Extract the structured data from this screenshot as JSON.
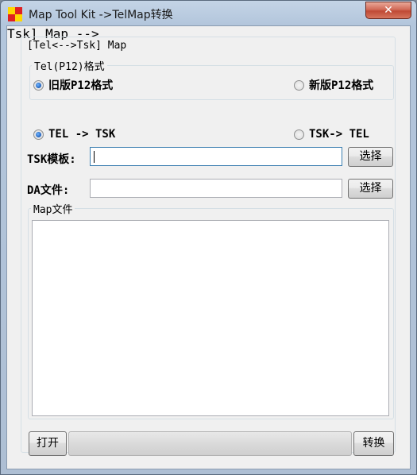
{
  "window": {
    "title": "Map Tool Kit ->TelMap转换",
    "close_label": "✕"
  },
  "main_group": {
    "title": "[Tel<-->Tsk] Map"
  },
  "format_group": {
    "title": "Tel(P12)格式",
    "options": [
      {
        "label": "旧版P12格式",
        "checked": true
      },
      {
        "label": "新版P12格式",
        "checked": false
      }
    ]
  },
  "direction": {
    "options": [
      {
        "label": "TEL -> TSK",
        "checked": true
      },
      {
        "label": "TSK-> TEL",
        "checked": false
      }
    ]
  },
  "tsk_template": {
    "label": "TSK模板:",
    "value": "",
    "button": "选择"
  },
  "da_file": {
    "label": "DA文件:",
    "value": "",
    "button": "选择"
  },
  "map_group": {
    "title": "Map文件"
  },
  "bottom": {
    "open_button": "打开",
    "convert_button": "转换",
    "progress": 0
  }
}
